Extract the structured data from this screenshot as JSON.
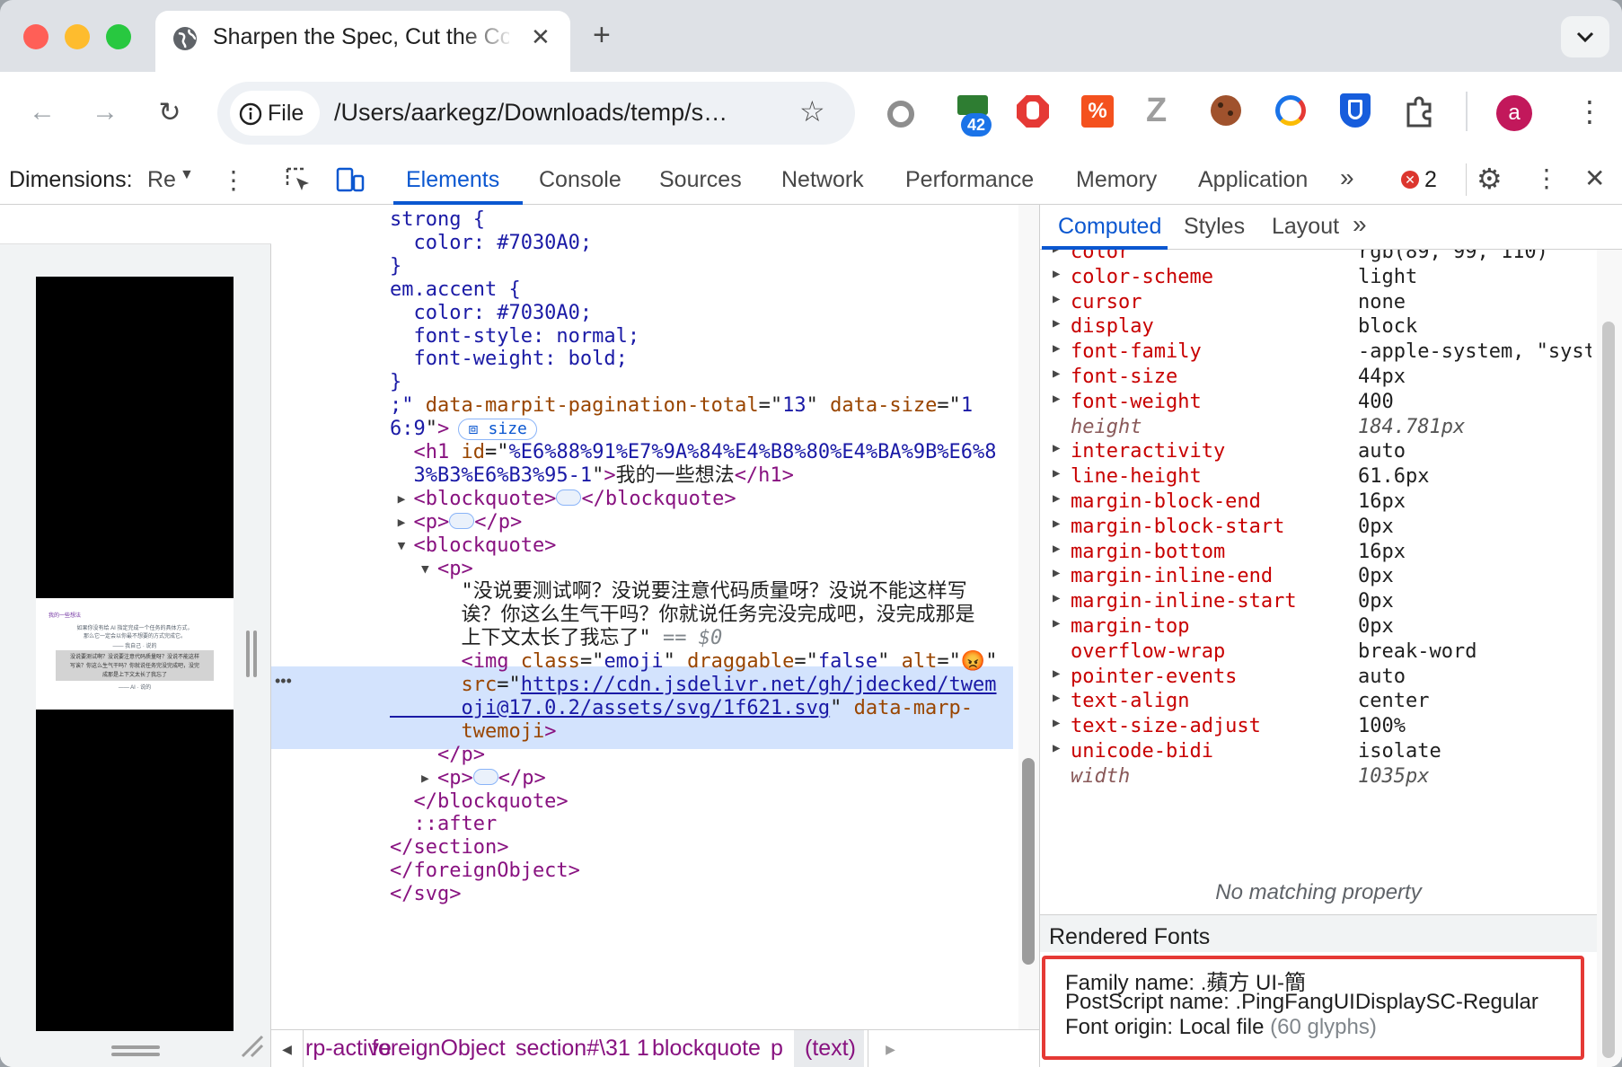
{
  "browser": {
    "tab_title": "Sharpen the Spec, Cut the Co",
    "address_chip": "File",
    "url": "/Users/aarkegz/Downloads/temp/s…",
    "ext_badge": "42",
    "avatar_letter": "a"
  },
  "devtools": {
    "dimensions_label": "Dimensions:",
    "dimensions_value": "Re",
    "tabs": [
      "Elements",
      "Console",
      "Sources",
      "Network",
      "Performance",
      "Memory",
      "Application"
    ],
    "error_count": "2",
    "right_tabs": [
      "Computed",
      "Styles",
      "Layout"
    ],
    "elements_lines": [
      {
        "segs": [
          {
            "c": "css",
            "t": "strong {"
          }
        ]
      },
      {
        "segs": [
          {
            "c": "css",
            "t": "  color: #7030A0;"
          }
        ]
      },
      {
        "segs": [
          {
            "c": "css",
            "t": "}"
          }
        ]
      },
      {
        "segs": [
          {
            "c": "css",
            "t": "em.accent {"
          }
        ]
      },
      {
        "segs": [
          {
            "c": "css",
            "t": "  color: #7030A0;"
          }
        ]
      },
      {
        "segs": [
          {
            "c": "css",
            "t": "  font-style: normal;"
          }
        ]
      },
      {
        "segs": [
          {
            "c": "css",
            "t": "  font-weight: bold;"
          }
        ]
      },
      {
        "segs": [
          {
            "c": "css",
            "t": "}"
          }
        ]
      },
      {
        "segs": [
          {
            "c": "av",
            "t": ";\""
          },
          {
            "c": "an",
            "t": " data-marpit-pagination-total"
          },
          {
            "c": "tx",
            "t": "=\""
          },
          {
            "c": "av",
            "t": "13"
          },
          {
            "c": "tx",
            "t": "\""
          },
          {
            "c": "an",
            "t": " data-size"
          },
          {
            "c": "tx",
            "t": "=\""
          },
          {
            "c": "av",
            "t": "1"
          }
        ]
      },
      {
        "segs": [
          {
            "c": "av",
            "t": "6:9"
          },
          {
            "c": "tx",
            "t": "\""
          },
          {
            "c": "tg",
            "t": ">"
          }
        ],
        "badge": "size"
      },
      {
        "segs": [
          {
            "c": "tg",
            "t": "  <h1"
          },
          {
            "c": "an",
            "t": " id"
          },
          {
            "c": "tx",
            "t": "=\""
          },
          {
            "c": "av",
            "t": "%E6%88%91%E7%9A%84%E4%B8%80%E4%BA%9B%E6%8"
          }
        ]
      },
      {
        "segs": [
          {
            "c": "av",
            "t": "  3%B3%E6%B3%95-1"
          },
          {
            "c": "tx",
            "t": "\""
          },
          {
            "c": "tg",
            "t": ">"
          },
          {
            "c": "tx",
            "t": "我的一些想法"
          },
          {
            "c": "tg",
            "t": "</h1>"
          }
        ]
      },
      {
        "segs": [
          {
            "c": "tg",
            "t": "  <blockquote>"
          }
        ],
        "ellipsis": true,
        "close": "</blockquote>",
        "arrow": "right"
      },
      {
        "segs": [
          {
            "c": "tg",
            "t": "  <p>"
          }
        ],
        "ellipsis": true,
        "close": "</p>",
        "arrow": "right"
      },
      {
        "segs": [
          {
            "c": "tg",
            "t": "  <blockquote>"
          }
        ],
        "arrow": "down"
      },
      {
        "segs": [
          {
            "c": "tg",
            "t": "    <p>"
          }
        ],
        "arrow": "down"
      },
      {
        "segs": [
          {
            "c": "tx",
            "t": "      \"没说要测试啊？没说要注意代码质量呀？没说不能这样写"
          }
        ]
      },
      {
        "segs": [
          {
            "c": "tx",
            "t": "      诶？你这么生气干吗？你就说任务完没完成吧，没完成那是"
          }
        ]
      },
      {
        "segs": [
          {
            "c": "tx",
            "t": "      上下文太长了我忘了\""
          },
          {
            "c": "dim",
            "t": " == $0"
          }
        ]
      },
      {
        "segs": [
          {
            "c": "tg",
            "t": "      <img"
          },
          {
            "c": "an",
            "t": " class"
          },
          {
            "c": "tx",
            "t": "=\""
          },
          {
            "c": "av",
            "t": "emoji"
          },
          {
            "c": "tx",
            "t": "\""
          },
          {
            "c": "an",
            "t": " draggable"
          },
          {
            "c": "tx",
            "t": "=\""
          },
          {
            "c": "av",
            "t": "false"
          },
          {
            "c": "tx",
            "t": "\""
          },
          {
            "c": "an",
            "t": " alt"
          },
          {
            "c": "tx",
            "t": "=\""
          },
          {
            "c": "av",
            "t": "😡"
          },
          {
            "c": "tx",
            "t": "\""
          }
        ]
      },
      {
        "segs": [
          {
            "c": "an",
            "t": "      src"
          },
          {
            "c": "tx",
            "t": "=\""
          },
          {
            "c": "lnk",
            "t": "https://cdn.jsdelivr.net/gh/jdecked/twem"
          }
        ]
      },
      {
        "segs": [
          {
            "c": "lnk",
            "t": "      oji@17.0.2/assets/svg/1f621.svg"
          },
          {
            "c": "tx",
            "t": "\""
          },
          {
            "c": "an",
            "t": " data-marp-"
          }
        ]
      },
      {
        "segs": [
          {
            "c": "an",
            "t": "      twemoji"
          },
          {
            "c": "tg",
            "t": ">"
          }
        ]
      },
      {
        "segs": [
          {
            "c": "tg",
            "t": "    </p>"
          }
        ]
      },
      {
        "segs": [
          {
            "c": "tg",
            "t": "    <p>"
          }
        ],
        "ellipsis": true,
        "close": "</p>",
        "arrow": "right"
      },
      {
        "segs": [
          {
            "c": "tg",
            "t": "  </blockquote>"
          }
        ]
      },
      {
        "segs": [
          {
            "c": "tg",
            "t": "  ::after"
          }
        ]
      },
      {
        "segs": [
          {
            "c": "tg",
            "t": "</section>"
          }
        ]
      },
      {
        "segs": [
          {
            "c": "tg",
            "t": "</foreignObject>"
          }
        ]
      },
      {
        "segs": [
          {
            "c": "tg",
            "t": "</svg>"
          }
        ]
      }
    ],
    "breadcrumbs": [
      "rp-active",
      "foreignObject",
      "section#\\31 1",
      "blockquote",
      "p",
      "(text)"
    ],
    "computed": [
      {
        "name": "color",
        "value": "rgb(89, 99, 110)"
      },
      {
        "name": "color-scheme",
        "value": "light"
      },
      {
        "name": "cursor",
        "value": "none"
      },
      {
        "name": "display",
        "value": "block"
      },
      {
        "name": "font-family",
        "value": "-apple-system, \"syst"
      },
      {
        "name": "font-size",
        "value": "44px"
      },
      {
        "name": "font-weight",
        "value": "400"
      },
      {
        "name": "height",
        "value": "184.781px",
        "inherited": true
      },
      {
        "name": "interactivity",
        "value": "auto"
      },
      {
        "name": "line-height",
        "value": "61.6px"
      },
      {
        "name": "margin-block-end",
        "value": "16px"
      },
      {
        "name": "margin-block-start",
        "value": "0px"
      },
      {
        "name": "margin-bottom",
        "value": "16px"
      },
      {
        "name": "margin-inline-end",
        "value": "0px"
      },
      {
        "name": "margin-inline-start",
        "value": "0px"
      },
      {
        "name": "margin-top",
        "value": "0px"
      },
      {
        "name": "overflow-wrap",
        "value": "break-word",
        "noarrow": true
      },
      {
        "name": "pointer-events",
        "value": "auto"
      },
      {
        "name": "text-align",
        "value": "center"
      },
      {
        "name": "text-size-adjust",
        "value": "100%"
      },
      {
        "name": "unicode-bidi",
        "value": "isolate"
      },
      {
        "name": "width",
        "value": "1035px",
        "inherited": true
      }
    ],
    "no_matching": "No matching property",
    "rendered_fonts_title": "Rendered Fonts",
    "font_family": "Family name: .蘋方 UI-簡",
    "font_postscript": "PostScript name: .PingFangUIDisplaySC-Regular",
    "font_origin": "Font origin: Local file",
    "font_glyphs": "(60 glyphs)"
  },
  "slide": {
    "title": "我的一些想法",
    "line1": "如果你没有给 AI 指定完成一个任务的具体方式，",
    "line2": "那么它一定会以你最不想要的方式完成它。",
    "attrib1": "—— 我自己 · 说的",
    "quote1": "没说要测试啊？没说要注意代码质量呀？没说不能这样",
    "quote2": "写诶？你这么生气干吗？你就说任务完没完成吧，没完",
    "quote3": "成那是上下文太长了我忘了",
    "attrib2": "—— AI · 说的"
  },
  "colors": {
    "accent": "#0b57d0",
    "highlight_box": "#e53935"
  }
}
